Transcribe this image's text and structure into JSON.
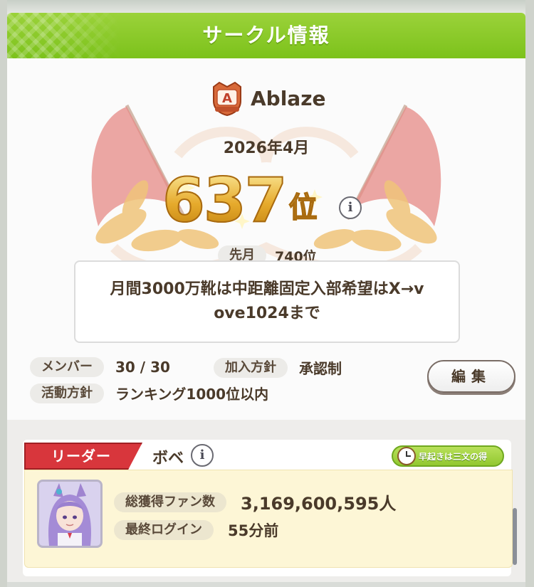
{
  "header": {
    "title": "サークル情報"
  },
  "circle": {
    "name": "Ablaze",
    "crest_letter": "A",
    "period": "2026年4月",
    "rank": "637",
    "rank_unit": "位",
    "info_icon": "i",
    "last_month_label": "先月",
    "last_month_value": "740位",
    "message": "月間3000万靴は中距離固定入部希望はX→v\nove1024まで"
  },
  "details": {
    "members_label": "メンバー",
    "members_value": "30 / 30",
    "join_policy_label": "加入方針",
    "join_policy_value": "承認制",
    "activity_label": "活動方針",
    "activity_value": "ランキング1000位以内",
    "edit_label": "編集"
  },
  "leader": {
    "tag": "リーダー",
    "name": "ボベ",
    "info_icon": "i",
    "title_badge": "早起きは三文の得",
    "fans_label": "総獲得ファン数",
    "fans_value": "3,169,600,595人",
    "login_label": "最終ログイン",
    "login_value": "55分前"
  },
  "colors": {
    "header": "#8cca2a",
    "rank_gold": "#e6aa2c",
    "leader_tag": "#d8363c",
    "stats_bg": "#fdf6d6"
  }
}
